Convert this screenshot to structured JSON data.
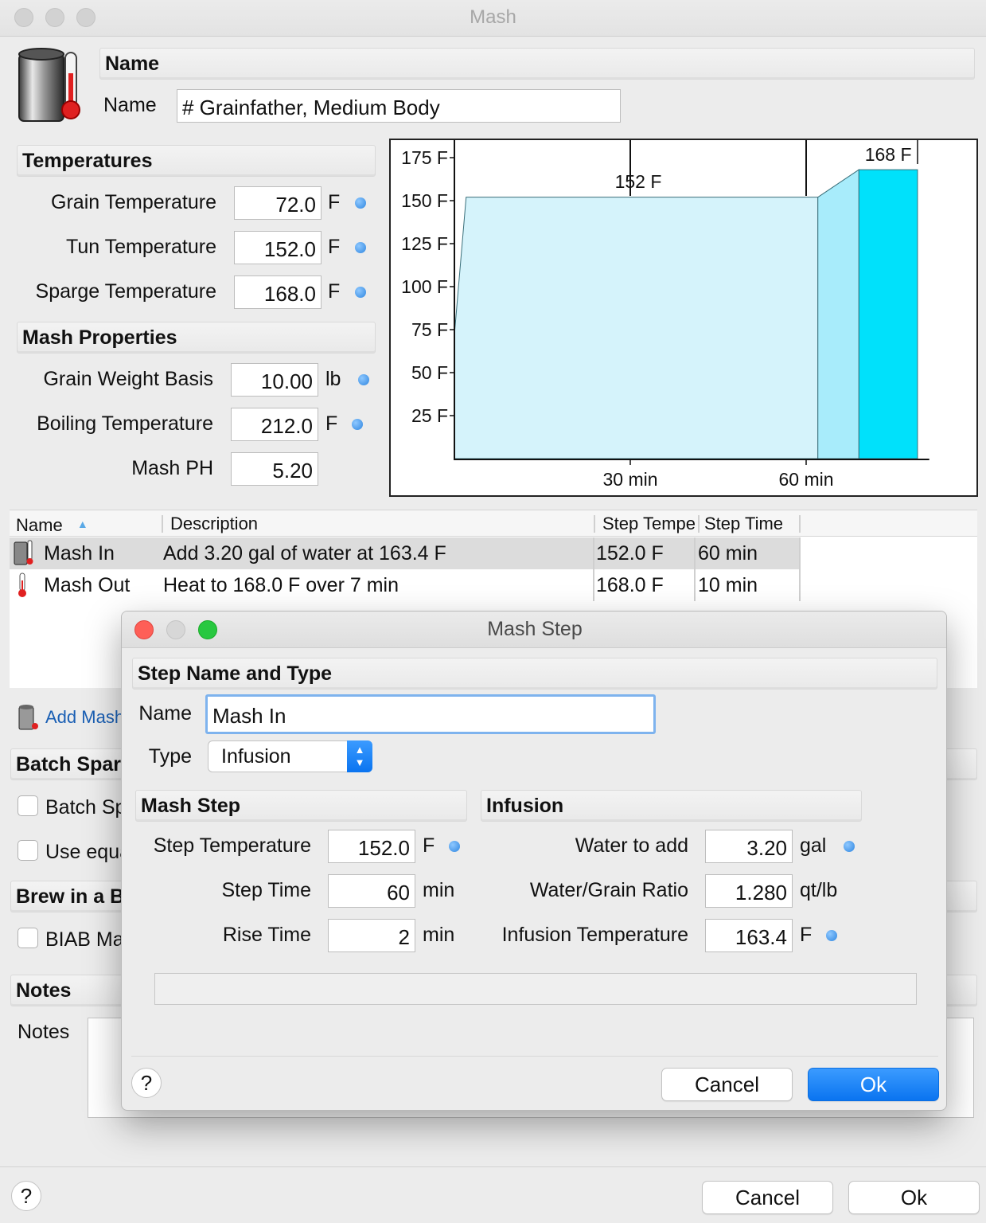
{
  "window": {
    "title": "Mash"
  },
  "name_section": {
    "header": "Name",
    "name_label": "Name",
    "name_value": "# Grainfather, Medium Body"
  },
  "temperatures": {
    "header": "Temperatures",
    "grain": {
      "label": "Grain Temperature",
      "value": "72.0",
      "unit": "F"
    },
    "tun": {
      "label": "Tun Temperature",
      "value": "152.0",
      "unit": "F"
    },
    "sparge": {
      "label": "Sparge Temperature",
      "value": "168.0",
      "unit": "F"
    }
  },
  "mash_properties": {
    "header": "Mash Properties",
    "grain_weight": {
      "label": "Grain Weight Basis",
      "value": "10.00",
      "unit": "lb"
    },
    "boiling": {
      "label": "Boiling Temperature",
      "value": "212.0",
      "unit": "F"
    },
    "ph": {
      "label": "Mash PH",
      "value": "5.20"
    }
  },
  "chart_data": {
    "type": "area",
    "title": "",
    "xlabel": "",
    "ylabel": "",
    "y_ticks": [
      "175 F",
      "150 F",
      "125 F",
      "100 F",
      "75 F",
      "50 F",
      "25 F"
    ],
    "x_ticks": [
      "30 min",
      "60 min"
    ],
    "ylim": [
      0,
      180
    ],
    "xlim": [
      0,
      81
    ],
    "annotations": [
      "152 F",
      "168 F"
    ],
    "series": [
      {
        "color": "#d5f3fb",
        "x": [
          0,
          0,
          2,
          2,
          62,
          62
        ],
        "y": [
          0,
          72,
          152,
          152,
          152,
          0
        ]
      },
      {
        "color": "#a8ecfb",
        "x": [
          62,
          62,
          69,
          69
        ],
        "y": [
          0,
          152,
          168,
          0
        ]
      },
      {
        "color": "#00e1fb",
        "x": [
          69,
          69,
          79,
          79
        ],
        "y": [
          0,
          168,
          168,
          0
        ]
      }
    ]
  },
  "steps_table": {
    "columns": [
      "Name",
      "Description",
      "Step Tempe",
      "Step Time"
    ],
    "rows": [
      {
        "name": "Mash In",
        "description": "Add 3.20 gal of water at 163.4 F",
        "temp": "152.0 F",
        "time": "60 min"
      },
      {
        "name": "Mash Out",
        "description": "Heat to 168.0 F over 7 min",
        "temp": "168.0 F",
        "time": "10 min"
      }
    ]
  },
  "add_link": "Add Mash",
  "batch_sparge": {
    "header": "Batch Sparge",
    "opt1": "Batch Sparge",
    "opt2": "Use equal"
  },
  "biab": {
    "header": "Brew in a Bag",
    "opt1": "BIAB Mash"
  },
  "notes": {
    "header": "Notes",
    "label": "Notes"
  },
  "footer": {
    "help": "?",
    "cancel": "Cancel",
    "ok": "Ok"
  },
  "dialog": {
    "title": "Mash Step",
    "section1": "Step Name and Type",
    "name_label": "Name",
    "name_value": "Mash In",
    "type_label": "Type",
    "type_value": "Infusion",
    "mash_step_header": "Mash Step",
    "infusion_header": "Infusion",
    "step_temp": {
      "label": "Step Temperature",
      "value": "152.0",
      "unit": "F"
    },
    "step_time": {
      "label": "Step Time",
      "value": "60",
      "unit": "min"
    },
    "rise_time": {
      "label": "Rise Time",
      "value": "2",
      "unit": "min"
    },
    "water_add": {
      "label": "Water to add",
      "value": "3.20",
      "unit": "gal"
    },
    "ratio": {
      "label": "Water/Grain Ratio",
      "value": "1.280",
      "unit": "qt/lb"
    },
    "infusion_temp": {
      "label": "Infusion Temperature",
      "value": "163.4",
      "unit": "F"
    },
    "help": "?",
    "cancel": "Cancel",
    "ok": "Ok"
  }
}
